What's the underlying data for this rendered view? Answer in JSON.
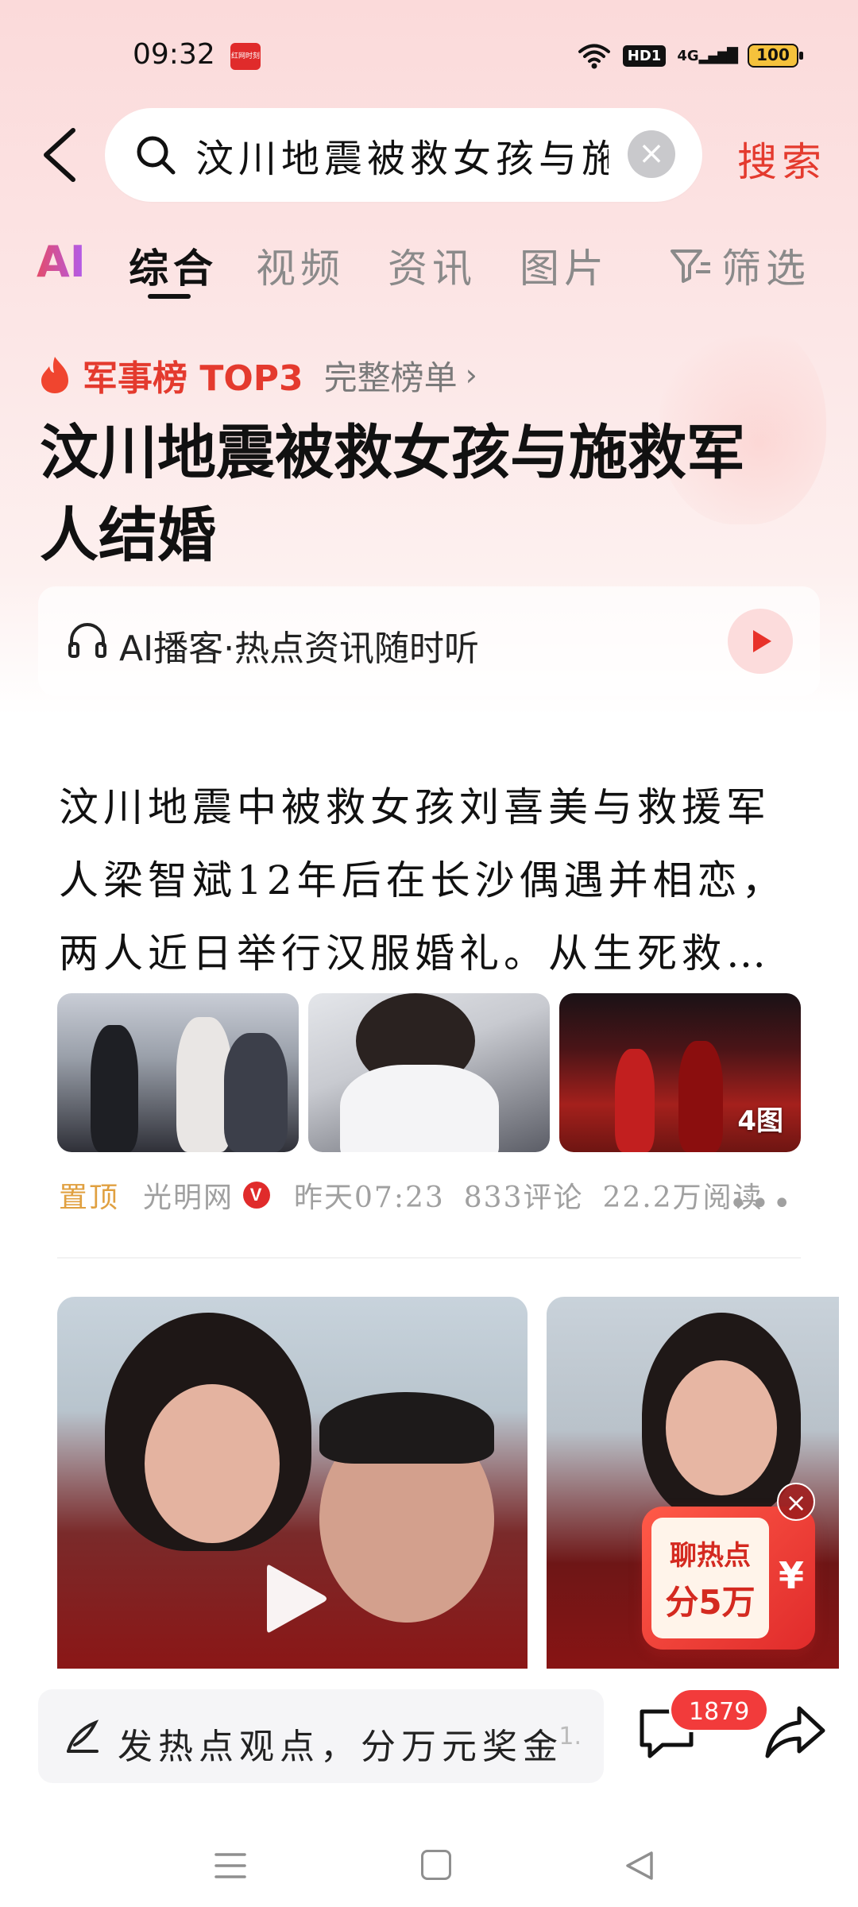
{
  "status_bar": {
    "time": "09:32",
    "app_badge": "红网时刻",
    "network": "4G",
    "hd": "HD1",
    "battery": "100"
  },
  "search": {
    "query": "汶川地震被救女孩与施",
    "submit_label": "搜索"
  },
  "tabs": {
    "ai": "AI",
    "items": [
      "综合",
      "视频",
      "资讯",
      "图片"
    ],
    "active": "综合",
    "filter_label": "筛选"
  },
  "ranking": {
    "label": "军事榜 TOP3",
    "full_list": "完整榜单"
  },
  "headline": "汶川地震被救女孩与施救军人结婚",
  "podcast": {
    "label": "AI播客·热点资讯随时听"
  },
  "article": {
    "summary": "汶川地震中被救女孩刘喜美与救援军人梁智斌12年后在长沙偶遇并相恋，两人近日举行汉服婚礼。从生死救…",
    "image_count": "4图",
    "meta": {
      "pinned": "置顶",
      "source": "光明网",
      "verified": "V",
      "time": "昨天07:23",
      "comments": "833评论",
      "reads": "22.2万阅读"
    }
  },
  "promo": {
    "line1": "聊热点",
    "line2": "分5万",
    "currency": "¥"
  },
  "bottom_bar": {
    "comment_placeholder": "发热点观点，分万元奖金",
    "comment_suffix": "1.",
    "comment_count": "1879"
  },
  "colors": {
    "accent_red": "#e43a2e",
    "pin_orange": "#e0a040",
    "badge_red": "#f23b3b"
  }
}
